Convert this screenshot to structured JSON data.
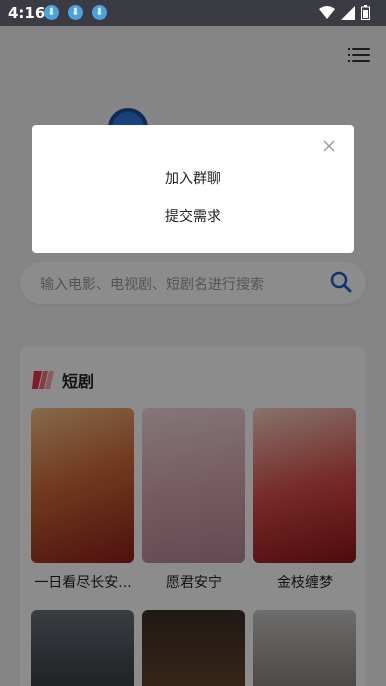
{
  "status_bar": {
    "time": "4:16"
  },
  "search": {
    "placeholder": "输入电影、电视剧、短剧名进行搜索"
  },
  "section": {
    "title": "短剧",
    "items": [
      {
        "caption": "一日看尽长安..."
      },
      {
        "caption": "愿君安宁"
      },
      {
        "caption": "金枝缠梦"
      }
    ]
  },
  "dialog": {
    "option_1": "加入群聊",
    "option_2": "提交需求"
  }
}
